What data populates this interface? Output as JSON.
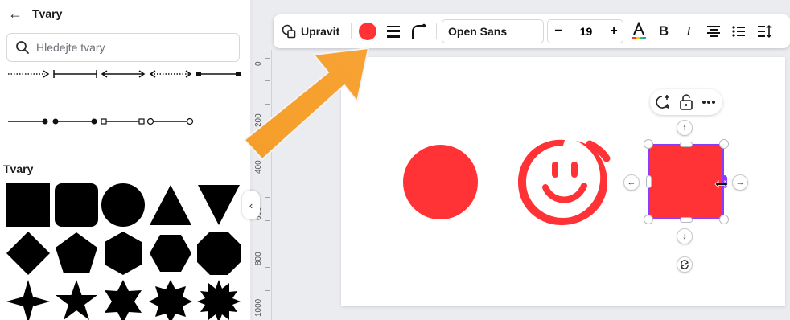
{
  "left_panel": {
    "title": "Tvary",
    "search_placeholder": "Hledejte tvary",
    "shapes_heading": "Tvary"
  },
  "toolbar": {
    "edit_label": "Upravit",
    "font_name": "Open Sans",
    "font_size": "19",
    "minus": "−",
    "plus": "+",
    "shape_color": "#ff3236"
  },
  "ruler": {
    "labels": [
      "0",
      "200",
      "400",
      "600",
      "800",
      "1000"
    ]
  },
  "colors": {
    "accent": "#ff3236",
    "selection": "#8b3dff",
    "arrow": "#f7a233"
  }
}
